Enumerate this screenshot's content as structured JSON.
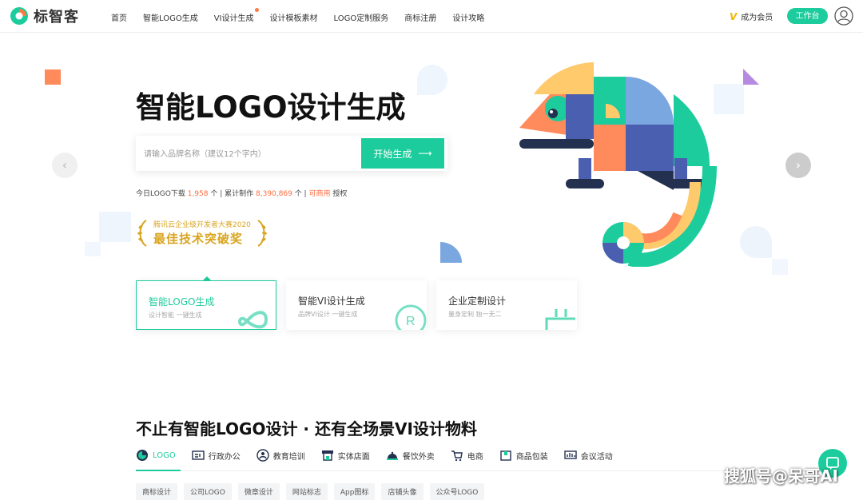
{
  "header": {
    "brand": "标智客",
    "nav": [
      {
        "label": "首页",
        "dot": false
      },
      {
        "label": "智能LOGO生成",
        "dot": false
      },
      {
        "label": "VI设计生成",
        "dot": true
      },
      {
        "label": "设计模板素材",
        "dot": false
      },
      {
        "label": "LOGO定制服务",
        "dot": false
      },
      {
        "label": "商标注册",
        "dot": false
      },
      {
        "label": "设计攻略",
        "dot": false
      }
    ],
    "member": "成为会员",
    "workbench": "工作台"
  },
  "hero": {
    "title": "智能LOGO设计生成",
    "search_placeholder": "请输入品牌名称（建议12个字内）",
    "start_button": "开始生成",
    "stats": {
      "p1": "今日LOGO下载",
      "today": "1,958",
      "p2": "个 | 累计制作",
      "total": "8,390,869",
      "p3": "个 |",
      "commercial": "可商用",
      "p4": "授权"
    },
    "award": {
      "line1": "腾讯云企业级开发者大赛2020",
      "line2": "最佳技术突破奖"
    }
  },
  "cards": [
    {
      "title": "智能LOGO生成",
      "subtitle": "设计智能 一键生成"
    },
    {
      "title": "智能VI设计生成",
      "subtitle": "品牌VI设计 一键生成"
    },
    {
      "title": "企业定制设计",
      "subtitle": "量身定制 独一无二"
    }
  ],
  "section": {
    "title": "不止有智能LOGO设计 · 还有全场景VI设计物料",
    "tabs": [
      {
        "label": "LOGO",
        "icon": "logo-tab-icon"
      },
      {
        "label": "行政办公",
        "icon": "id-card-icon"
      },
      {
        "label": "教育培训",
        "icon": "graduation-icon"
      },
      {
        "label": "实体店面",
        "icon": "storefront-icon"
      },
      {
        "label": "餐饮外卖",
        "icon": "cloche-icon"
      },
      {
        "label": "电商",
        "icon": "cart-icon"
      },
      {
        "label": "商品包装",
        "icon": "package-icon"
      },
      {
        "label": "会议活动",
        "icon": "billboard-icon"
      }
    ],
    "chips": [
      "商标设计",
      "公司LOGO",
      "微章设计",
      "网站标志",
      "App图标",
      "店铺头像",
      "公众号LOGO"
    ]
  },
  "watermark": "搜狐号@呆哥AI",
  "colors": {
    "accent": "#1ccc9c",
    "highlight": "#ff6a3d",
    "gold": "#d9a520"
  }
}
